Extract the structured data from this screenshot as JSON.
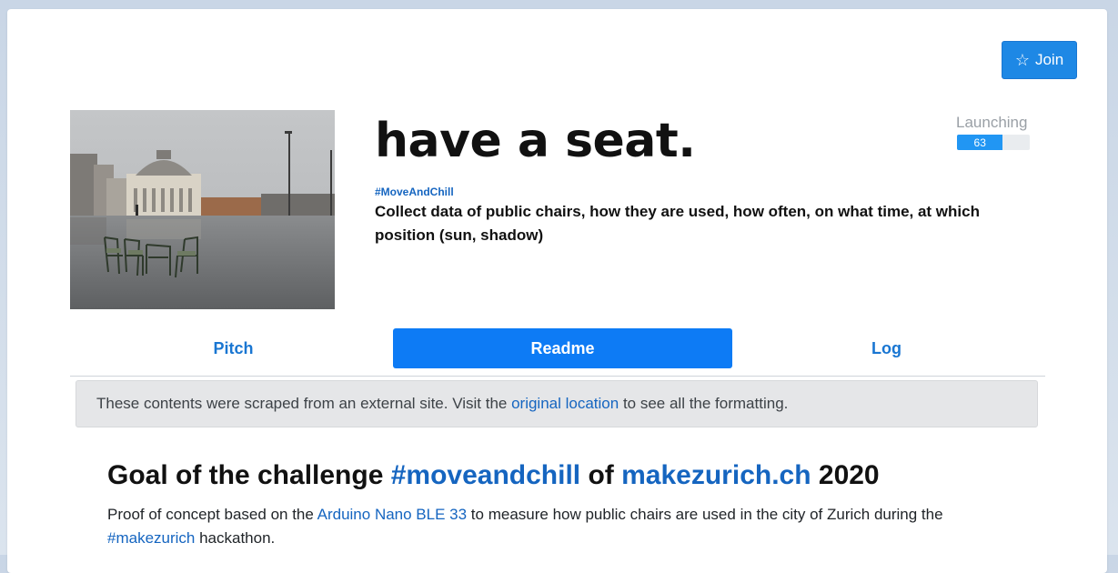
{
  "header": {
    "join_label": "Join",
    "join_icon": "star-outline-icon"
  },
  "project": {
    "title": "have a seat.",
    "hashtag": "#MoveAndChill",
    "summary": "Collect data of public chairs, how they are used, how often, on what time, at which position (sun, shadow)",
    "status": {
      "label": "Launching",
      "progress": 63,
      "progress_text": "63",
      "progress_max": 100
    }
  },
  "tabs": [
    {
      "label": "Pitch",
      "active": false
    },
    {
      "label": "Readme",
      "active": true
    },
    {
      "label": "Log",
      "active": false
    }
  ],
  "notice": {
    "text_before": "These contents were scraped from an external site. Visit the ",
    "link_text": "original location",
    "text_after": " to see all the formatting."
  },
  "readme": {
    "heading": {
      "part1": "Goal of the challenge ",
      "link1": "#moveandchill",
      "part2": " of ",
      "link2": "makezurich.ch",
      "part3": " 2020"
    },
    "paragraph": {
      "part1": "Proof of concept based on the ",
      "link1": "Arduino Nano BLE 33",
      "part2": " to measure how public chairs are used in the city of Zurich during the ",
      "link2": "#makezurich",
      "part3": " hackathon."
    }
  },
  "colors": {
    "accent": "#1e88e5",
    "tab_active": "#0d7bf5",
    "link": "#1565c0",
    "progress": "#2196f3"
  }
}
